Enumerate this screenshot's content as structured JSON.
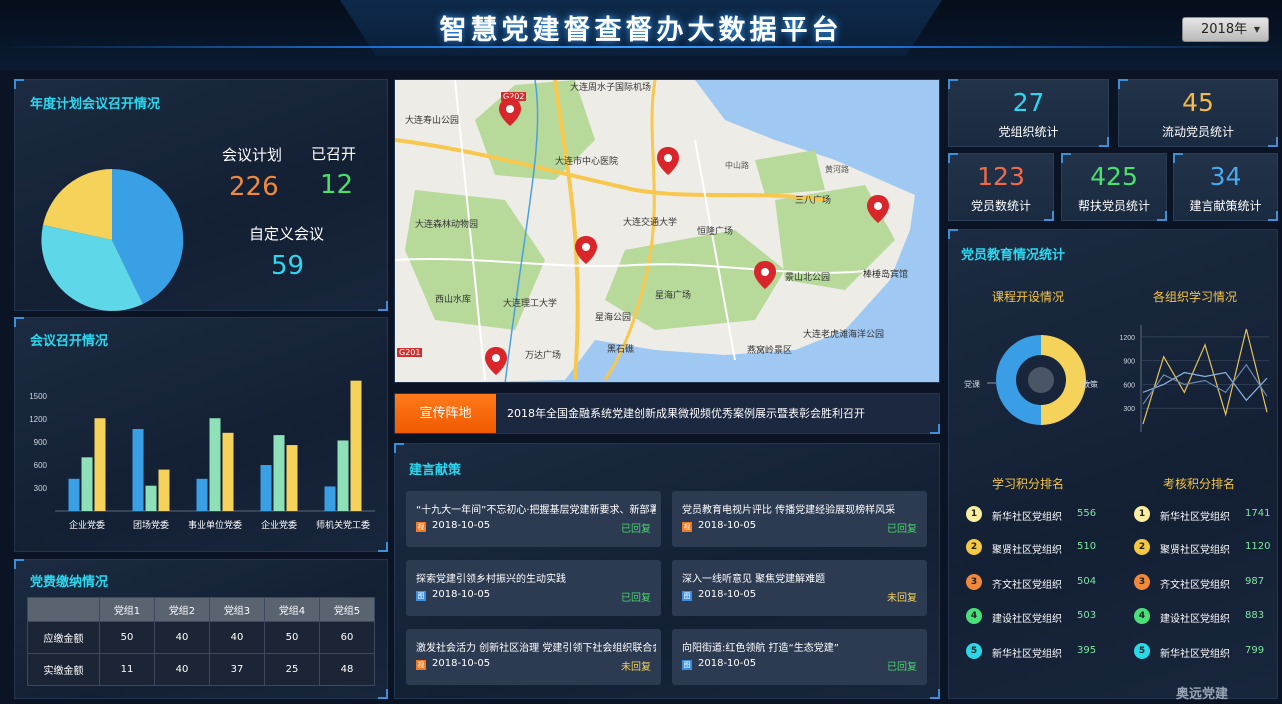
{
  "header": {
    "title": "智慧党建督查督办大数据平台",
    "year": "2018年"
  },
  "meeting_plan": {
    "title": "年度计划会议召开情况",
    "plan_label": "会议计划",
    "plan_value": "226",
    "held_label": "已召开",
    "held_value": "12",
    "custom_label": "自定义会议",
    "custom_value": "59",
    "colors": [
      "#3aa0e6",
      "#5ed8e8",
      "#f5d25a"
    ]
  },
  "meeting_chart": {
    "title": "会议召开情况",
    "chart_data": {
      "type": "bar",
      "categories": [
        "企业党委",
        "团场党委",
        "事业单位党委",
        "企业党委",
        "师机关党工委"
      ],
      "series": [
        {
          "values": [
            420,
            1070,
            420,
            600,
            320
          ],
          "color": "#3aa0e6"
        },
        {
          "values": [
            700,
            330,
            1210,
            990,
            920
          ],
          "color": "#8ee0b8"
        },
        {
          "values": [
            1210,
            540,
            1020,
            860,
            1700
          ],
          "color": "#f5d25a"
        }
      ],
      "yticks": [
        "300",
        "600",
        "900",
        "1200",
        "1500"
      ],
      "ylim": [
        0,
        1800
      ]
    }
  },
  "party_fee": {
    "title": "党费缴纳情况",
    "columns": [
      "",
      "党组1",
      "党组2",
      "党组3",
      "党组4",
      "党组5"
    ],
    "rows": [
      {
        "label": "应缴金额",
        "values": [
          "50",
          "40",
          "40",
          "50",
          "60"
        ]
      },
      {
        "label": "实缴金额",
        "values": [
          "11",
          "40",
          "37",
          "25",
          "48"
        ]
      }
    ]
  },
  "map": {
    "labels": [
      "大连周水子国际机场",
      "大连寿山公园",
      "大连市中心医院",
      "大连森林动物园",
      "大连交通大学",
      "恒隆广场",
      "三八广场",
      "大连理工大学",
      "星海广场",
      "星海公园",
      "景山北公园",
      "棒棰岛宾馆",
      "万达广场",
      "大连老虎滩海洋公园",
      "燕窝岭景区",
      "黑石礁",
      "西山水库",
      "G202",
      "G201",
      "黄河路",
      "中山路"
    ],
    "colors": {
      "water": "#9fc8f2",
      "land": "#eeece6",
      "green": "#b7d99a",
      "road_major": "#f7c74e",
      "road": "#ffffff",
      "marker": "#d9262b"
    }
  },
  "news": {
    "tag": "宣传阵地",
    "text": "2018年全国金融系统党建创新成果微视频优秀案例展示暨表彰会胜利召开"
  },
  "suggestions": {
    "title": "建言献策",
    "items": [
      {
        "title": "“十九大一年间”不忘初心·把握基层党建新要求、新部署",
        "date": "2018-10-05",
        "status": "已回复",
        "icon": "视",
        "icon_color": "#f07a24",
        "status_color": "#49d36c"
      },
      {
        "title": "党员教育电视片评比 传播党建经验展现榜样风采",
        "date": "2018-10-05",
        "status": "已回复",
        "icon": "视",
        "icon_color": "#f07a24",
        "status_color": "#49d36c"
      },
      {
        "title": "探索党建引领乡村振兴的生动实践",
        "date": "2018-10-05",
        "status": "已回复",
        "icon": "图",
        "icon_color": "#3a8fe0",
        "status_color": "#49d36c"
      },
      {
        "title": "深入一线听意见 聚焦党建解难题",
        "date": "2018-10-05",
        "status": "未回复",
        "icon": "图",
        "icon_color": "#3a8fe0",
        "status_color": "#f5d25a"
      },
      {
        "title": "激发社会活力 创新社区治理 党建引领下社会组织联合会",
        "date": "2018-10-05",
        "status": "未回复",
        "icon": "视",
        "icon_color": "#f07a24",
        "status_color": "#f5d25a"
      },
      {
        "title": "向阳街道:红色领航 打造“生态党建”",
        "date": "2018-10-05",
        "status": "已回复",
        "icon": "图",
        "icon_color": "#3a8fe0",
        "status_color": "#49d36c"
      }
    ]
  },
  "stats": [
    {
      "value": "27",
      "label": "党组织统计",
      "color": "#2ad8f0"
    },
    {
      "value": "45",
      "label": "流动党员统计",
      "color": "#f5b94a"
    },
    {
      "value": "123",
      "label": "党员数统计",
      "color": "#f06a4a"
    },
    {
      "value": "425",
      "label": "帮扶党员统计",
      "color": "#49e06c"
    },
    {
      "value": "34",
      "label": "建言献策统计",
      "color": "#4aa8f0"
    }
  ],
  "education": {
    "title": "党员教育情况统计",
    "course_title": "课程开设情况",
    "course_chart": {
      "type": "pie",
      "labels": [
        "党课",
        "政策"
      ],
      "values": [
        75,
        25
      ],
      "colors": [
        "#3a9ee6",
        "#f5d25a"
      ]
    },
    "study_title": "各组织学习情况",
    "study_chart": {
      "type": "line",
      "yticks": [
        "300",
        "600",
        "900",
        "1200"
      ],
      "ylim": [
        0,
        1350
      ],
      "series": [
        {
          "values": [
            100,
            950,
            500,
            1100,
            220,
            1300,
            250
          ],
          "color": "#e8c25a"
        },
        {
          "values": [
            500,
            600,
            750,
            700,
            750,
            400,
            680
          ],
          "color": "#8ab4e0"
        },
        {
          "values": [
            350,
            720,
            600,
            650,
            500,
            850,
            450
          ],
          "color": "#6a88b0"
        }
      ]
    }
  },
  "study_rank": {
    "title": "学习积分排名",
    "items": [
      {
        "rank": "1",
        "name": "新华社区党组织",
        "score": "556",
        "color": "#f8eda0"
      },
      {
        "rank": "2",
        "name": "聚贤社区党组织",
        "score": "510",
        "color": "#f5c842"
      },
      {
        "rank": "3",
        "name": "齐文社区党组织",
        "score": "504",
        "color": "#f08a3a"
      },
      {
        "rank": "4",
        "name": "建设社区党组织",
        "score": "503",
        "color": "#49e07a"
      },
      {
        "rank": "5",
        "name": "新华社区党组织",
        "score": "395",
        "color": "#2ad8e8"
      }
    ]
  },
  "exam_rank": {
    "title": "考核积分排名",
    "items": [
      {
        "rank": "1",
        "name": "新华社区党组织",
        "score": "1741",
        "color": "#f8eda0"
      },
      {
        "rank": "2",
        "name": "聚贤社区党组织",
        "score": "1120",
        "color": "#f5c842"
      },
      {
        "rank": "3",
        "name": "齐文社区党组织",
        "score": "987",
        "color": "#f08a3a"
      },
      {
        "rank": "4",
        "name": "建设社区党组织",
        "score": "883",
        "color": "#49e07a"
      },
      {
        "rank": "5",
        "name": "新华社区党组织",
        "score": "799",
        "color": "#2ad8e8"
      }
    ]
  },
  "watermark": "奥远党建"
}
